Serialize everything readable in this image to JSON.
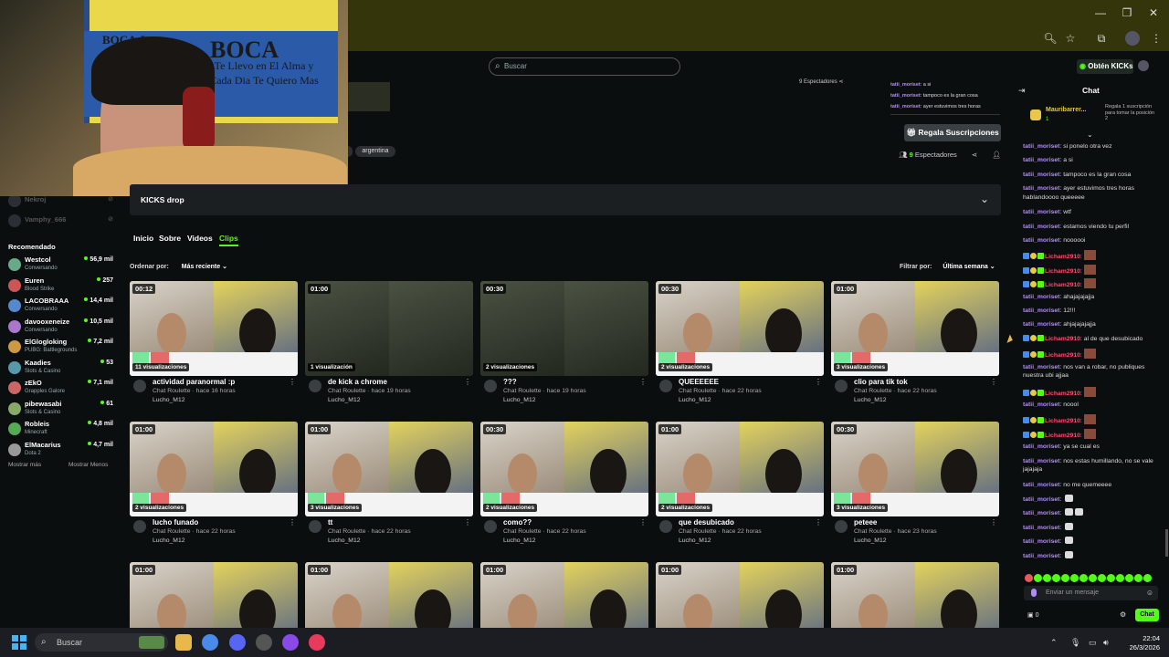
{
  "search": {
    "placeholder": "Buscar"
  },
  "kicks_button": "Obtén KICKs",
  "sidebar": {
    "following_faded": [
      {
        "name": "Nekroj"
      },
      {
        "name": "Vamphy_666"
      }
    ],
    "recommended_title": "Recomendado",
    "items": [
      {
        "name": "Westcol",
        "category": "Conversando",
        "viewers": "56,9 mil"
      },
      {
        "name": "Euren",
        "category": "Blood Strike",
        "viewers": "257"
      },
      {
        "name": "LACOBRAAA",
        "category": "Conversando",
        "viewers": "14,4 mil"
      },
      {
        "name": "davooxeneize",
        "category": "Conversando",
        "viewers": "10,5 mil"
      },
      {
        "name": "ElGlogloking",
        "category": "PUBG: Battlegrounds",
        "viewers": "7,2 mil"
      },
      {
        "name": "Kaadies",
        "category": "Slots & Casino",
        "viewers": "53"
      },
      {
        "name": "zEkO",
        "category": "Grapples Galore",
        "viewers": "7,1 mil"
      },
      {
        "name": "pibewasabi",
        "category": "Slots & Casino",
        "viewers": "61"
      },
      {
        "name": "Robleis",
        "category": "Minecraft",
        "viewers": "4,8 mil"
      },
      {
        "name": "ElMacarius",
        "category": "Dota 2",
        "viewers": "4,7 mil"
      }
    ],
    "show_more": "Mostrar más",
    "show_less": "Mostrar Menos"
  },
  "webcam": {
    "flag_logo": "BOCA Jrs",
    "flag_title": "BOCA",
    "flag_lines": "Te Llevo en El Alma y Cada Dia Te Quiero Mas"
  },
  "stream": {
    "tag": "argentina",
    "gift_button": "Regala Suscripciones",
    "viewers_count": "9",
    "viewers_label": "Espectadores",
    "viewers_top": "9 Espectadores",
    "mini_chat": [
      {
        "user": "tatii_moriset",
        "text": "a si"
      },
      {
        "user": "tatii_moriset",
        "text": "tampoco es la gran cosa"
      },
      {
        "user": "tatii_moriset",
        "text": "ayer estuvimos tres horas"
      }
    ],
    "drop_label": "KICKS drop"
  },
  "tabs": [
    "Inicio",
    "Sobre",
    "Videos",
    "Clips"
  ],
  "sort": {
    "label": "Ordenar por:",
    "value": "Más reciente"
  },
  "filter": {
    "label": "Filtrar por:",
    "value": "Última semana"
  },
  "clips": [
    {
      "duration": "00:12",
      "views": "11 visualizaciones",
      "title": "actividad paranormal :p",
      "category": "Chat Roulette",
      "age": "hace 16 horas",
      "author": "Lucho_M12",
      "game": false
    },
    {
      "duration": "01:00",
      "views": "1 visualización",
      "title": "de kick a chrome",
      "category": "Chat Roulette",
      "age": "hace 19 horas",
      "author": "Lucho_M12",
      "game": true
    },
    {
      "duration": "00:30",
      "views": "2 visualizaciones",
      "title": "???",
      "category": "Chat Roulette",
      "age": "hace 19 horas",
      "author": "Lucho_M12",
      "game": true
    },
    {
      "duration": "00:30",
      "views": "2 visualizaciones",
      "title": "QUEEEEEE",
      "category": "Chat Roulette",
      "age": "hace 22 horas",
      "author": "Lucho_M12",
      "game": false
    },
    {
      "duration": "01:00",
      "views": "3 visualizaciones",
      "title": "clio para tik tok",
      "category": "Chat Roulette",
      "age": "hace 22 horas",
      "author": "Lucho_M12",
      "game": false
    },
    {
      "duration": "01:00",
      "views": "2 visualizaciones",
      "title": "lucho funado",
      "category": "Chat Roulette",
      "age": "hace 22 horas",
      "author": "Lucho_M12",
      "game": false
    },
    {
      "duration": "01:00",
      "views": "3 visualizaciones",
      "title": "tt",
      "category": "Chat Roulette",
      "age": "hace 22 horas",
      "author": "Lucho_M12",
      "game": false
    },
    {
      "duration": "00:30",
      "views": "2 visualizaciones",
      "title": "como??",
      "category": "Chat Roulette",
      "age": "hace 22 horas",
      "author": "Lucho_M12",
      "game": false
    },
    {
      "duration": "01:00",
      "views": "2 visualizaciones",
      "title": "que desubicado",
      "category": "Chat Roulette",
      "age": "hace 22 horas",
      "author": "Lucho_M12",
      "game": false
    },
    {
      "duration": "00:30",
      "views": "3 visualizaciones",
      "title": "peteee",
      "category": "Chat Roulette",
      "age": "hace 23 horas",
      "author": "Lucho_M12",
      "game": false
    },
    {
      "duration": "01:00",
      "game": false
    },
    {
      "duration": "01:00",
      "game": false
    },
    {
      "duration": "01:00",
      "game": false
    },
    {
      "duration": "01:00",
      "game": false
    },
    {
      "duration": "01:00",
      "game": false
    }
  ],
  "chat": {
    "title": "Chat",
    "pinned": {
      "name": "Mauribarrer...",
      "sub": "1",
      "note": "Regala 1 suscripción para tomar la posición 2"
    },
    "messages": [
      {
        "user": "tatii_moriset",
        "text": "si ponelo otra vez"
      },
      {
        "user": "tatii_moriset",
        "text": "a si"
      },
      {
        "user": "tatii_moriset",
        "text": "tampoco es la gran cosa"
      },
      {
        "user": "tatii_moriset",
        "text": "ayer estuvimos tres horas hablandoooo queeeee"
      },
      {
        "user": "tatii_moriset",
        "text": "wtf"
      },
      {
        "user": "tatii_moriset",
        "text": "estamos viendo tu perfil"
      },
      {
        "user": "tatii_moriset",
        "text": "noooooi"
      },
      {
        "user": "Licham2910",
        "text": "",
        "emote": true,
        "badges": true
      },
      {
        "user": "Licham2910",
        "text": "",
        "emote": true,
        "badges": true
      },
      {
        "user": "Licham2910",
        "text": "",
        "emote": true,
        "badges": true
      },
      {
        "user": "tatii_moriset",
        "text": "ahajajajajja"
      },
      {
        "user": "tatii_moriset",
        "text": "12!!!"
      },
      {
        "user": "tatii_moriset",
        "text": "ahjajajajajja"
      },
      {
        "user": "Licham2910",
        "text": "al de que desubicado",
        "badges": true
      },
      {
        "user": "Licham2910",
        "text": "",
        "emote": true,
        "badges": true
      },
      {
        "user": "tatii_moriset",
        "text": "nos van a robar, no publiques nuestra ubi ajjaa"
      },
      {
        "user": "Licham2910",
        "text": "",
        "emote": true,
        "badges": true
      },
      {
        "user": "tatii_moriset",
        "text": "noool"
      },
      {
        "user": "Licham2910",
        "text": "",
        "emote": true,
        "badges": true
      },
      {
        "user": "Licham2910",
        "text": "",
        "emote": true,
        "badges": true
      },
      {
        "user": "tatii_moriset",
        "text": "ya se cual es"
      },
      {
        "user": "tatii_moriset",
        "text": "nos estas humillando, no se vale jajajaja"
      },
      {
        "user": "tatii_moriset",
        "text": "no me quemeeee"
      },
      {
        "user": "tatii_moriset",
        "text": "",
        "emote2": 1
      },
      {
        "user": "tatii_moriset",
        "text": "",
        "emote2": 2
      },
      {
        "user": "tatii_moriset",
        "text": "",
        "emote2": 1
      },
      {
        "user": "tatii_moriset",
        "text": "",
        "emote2": 1
      },
      {
        "user": "tatii_moriset",
        "text": "",
        "emote2": 1
      }
    ],
    "input_placeholder": "Enviar un mensaje",
    "kicks_count": "0",
    "send_label": "Chat"
  },
  "taskbar": {
    "search_placeholder": "Buscar",
    "time": "22:04",
    "date": "26/3/2026"
  },
  "colors": {
    "accent": "#53fc18",
    "username": "#b689ff",
    "username_alt": "#ff4d6d",
    "chrome": "#35350b"
  }
}
